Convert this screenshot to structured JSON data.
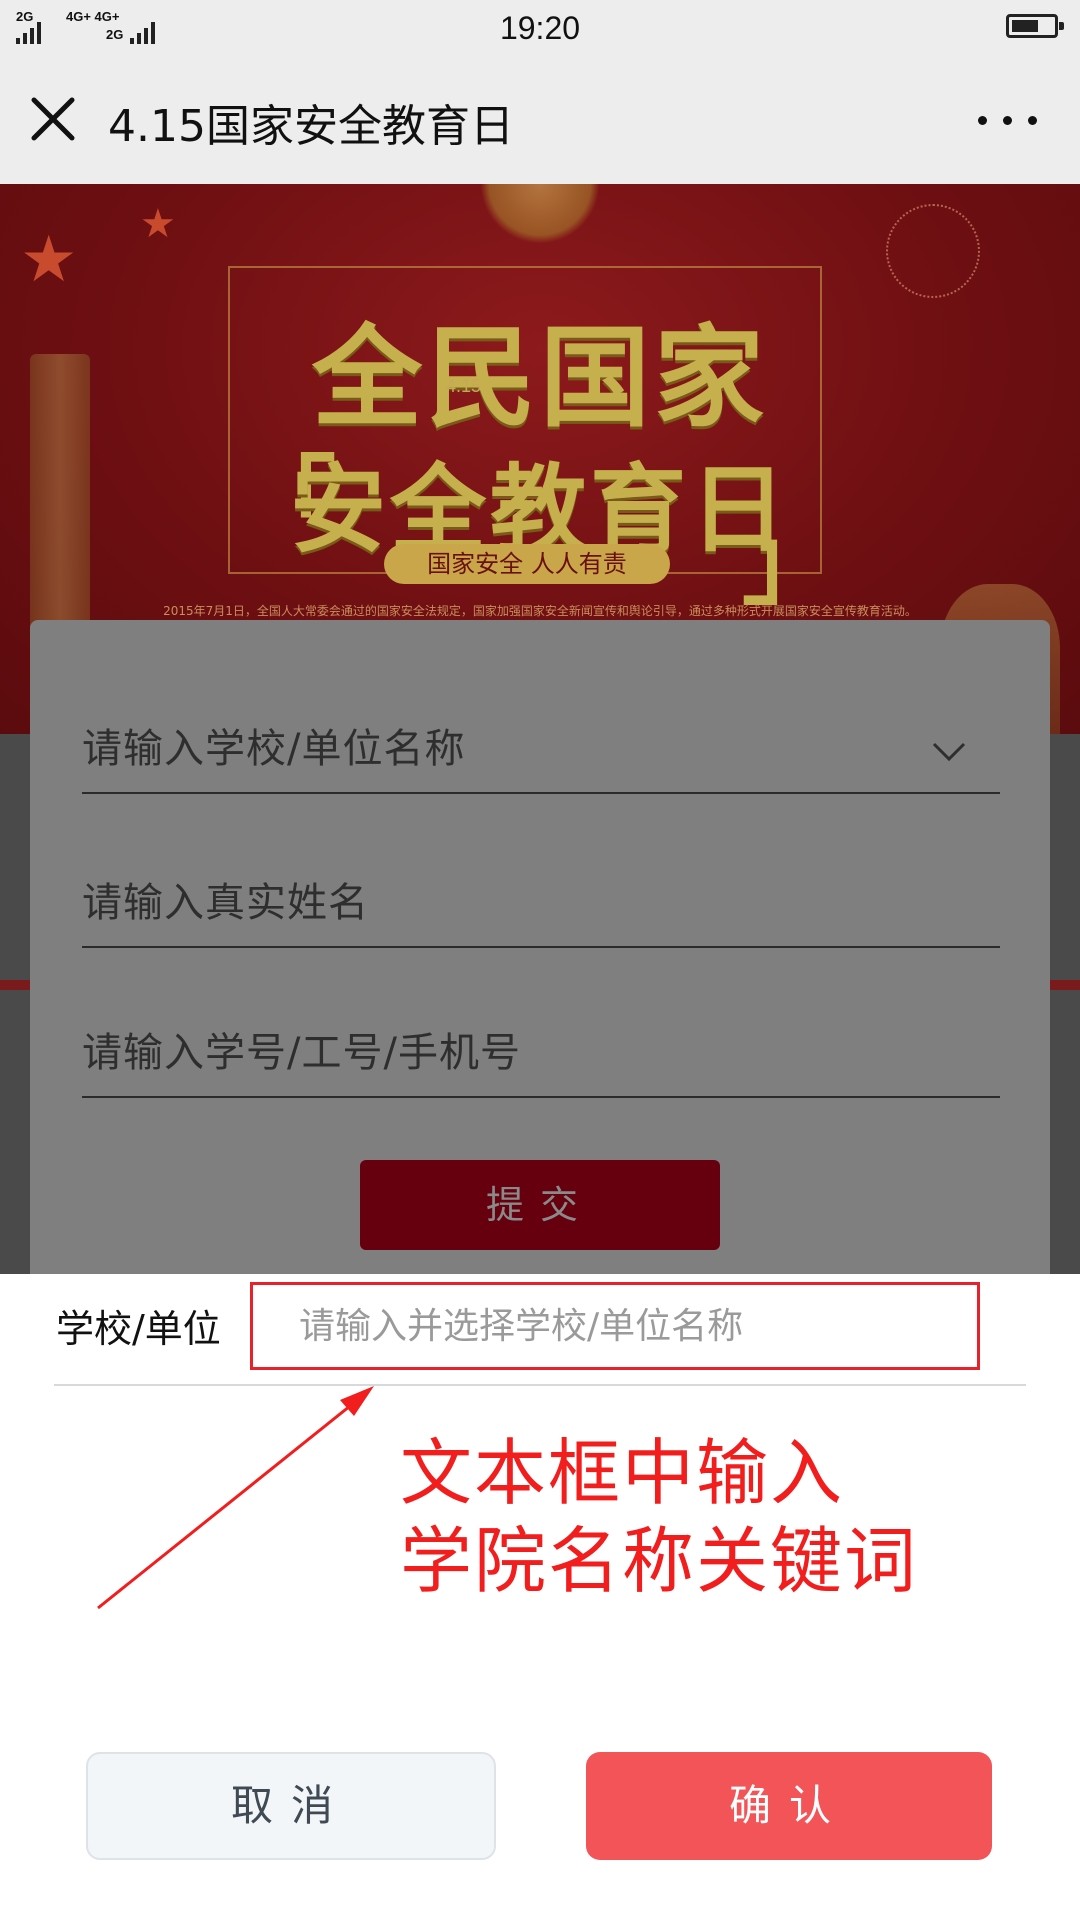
{
  "status_bar": {
    "signal_1_tag": "2G",
    "signal_2_tag": "4G+ 4G+",
    "signal_3_tag": "2G",
    "time": "19:20"
  },
  "nav": {
    "title": "4.15国家安全教育日",
    "close_icon": "close-icon",
    "more_icon": "more-icon"
  },
  "banner": {
    "headline_line1": "全民国家",
    "headline_line2": "安全教育日",
    "date_small": "4.15",
    "bracket_left": "「",
    "bracket_right": "」",
    "slogan": "国家安全 人人有责",
    "law_line": "2015年7月1日，全国人大常委会通过的国家安全法规定，国家加强国家安全新闻宣传和舆论引导，通过多种形式开展国家安全宣传教育活动。"
  },
  "form": {
    "school_placeholder": "请输入学校/单位名称",
    "name_placeholder": "请输入真实姓名",
    "id_placeholder": "请输入学号/工号/手机号",
    "submit_label": "提交"
  },
  "sheet": {
    "label": "学校/单位",
    "input_placeholder": "请输入并选择学校/单位名称",
    "input_value": "",
    "annotation_line1": "文本框中输入",
    "annotation_line2": "学院名称关键词",
    "cancel_label": "取消",
    "confirm_label": "确认"
  },
  "colors": {
    "highlight": "#e8222b",
    "annotation": "#f21d1d",
    "confirm": "#f25458",
    "submit": "#66000f"
  }
}
